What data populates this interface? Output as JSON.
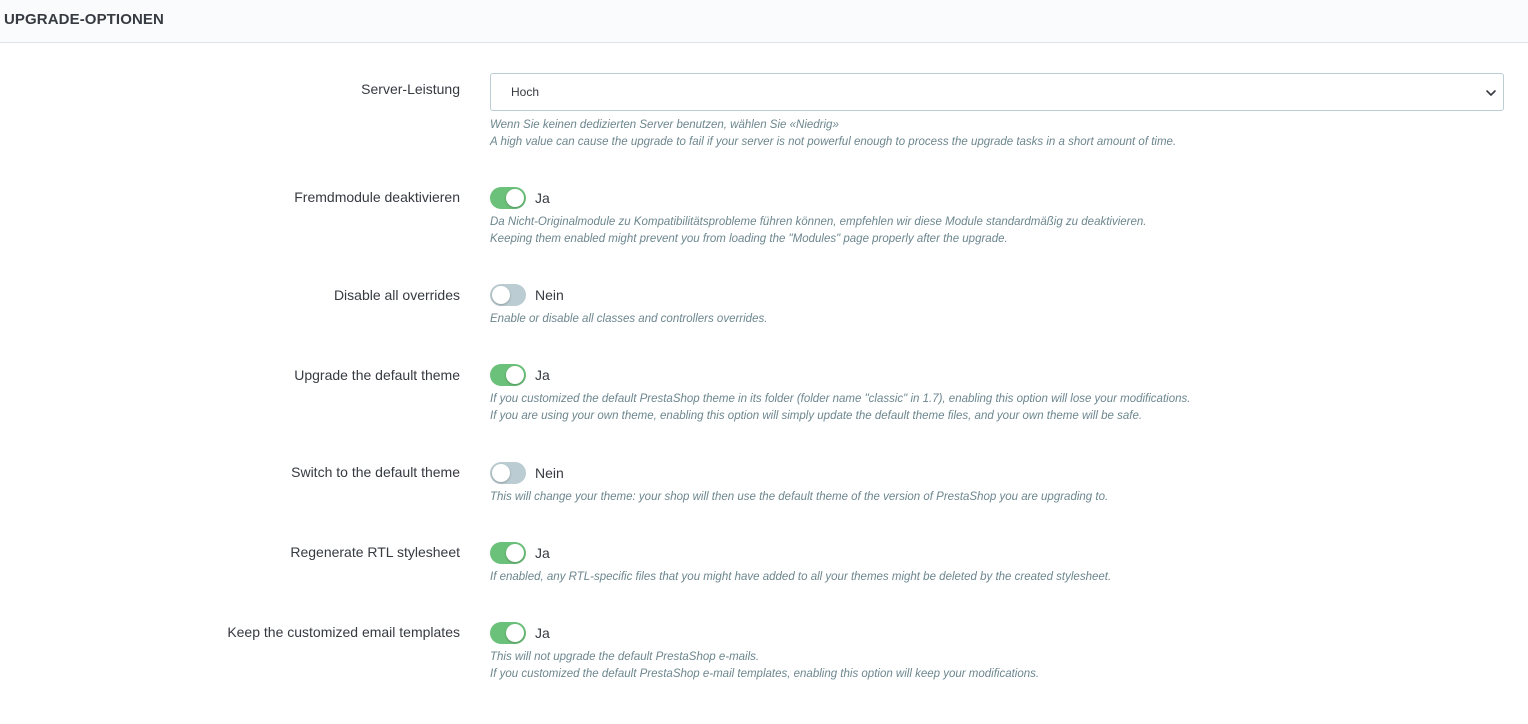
{
  "panel": {
    "title": "UPGRADE-OPTIONEN"
  },
  "colors": {
    "toggle_on": "#6cc17a",
    "toggle_off": "#bbcdd2",
    "help_text": "#6c868e"
  },
  "server_performance": {
    "label": "Server-Leistung",
    "selected": "Hoch",
    "icon": "chevron-down-icon",
    "help": [
      "Wenn Sie keinen dedizierten Server benutzen, wählen Sie «Niedrig»",
      "A high value can cause the upgrade to fail if your server is not powerful enough to process the upgrade tasks in a short amount of time."
    ]
  },
  "options": [
    {
      "label": "Fremdmodule deaktivieren",
      "enabled": true,
      "state": "Ja",
      "help": [
        "Da Nicht-Originalmodule zu Kompatibilitätsprobleme führen können, empfehlen wir diese Module standardmäßig zu deaktivieren.",
        "Keeping them enabled might prevent you from loading the \"Modules\" page properly after the upgrade."
      ]
    },
    {
      "label": "Disable all overrides",
      "enabled": false,
      "state": "Nein",
      "help": [
        "Enable or disable all classes and controllers overrides."
      ]
    },
    {
      "label": "Upgrade the default theme",
      "enabled": true,
      "state": "Ja",
      "help": [
        "If you customized the default PrestaShop theme in its folder (folder name \"classic\" in 1.7), enabling this option will lose your modifications.",
        "If you are using your own theme, enabling this option will simply update the default theme files, and your own theme will be safe."
      ]
    },
    {
      "label": "Switch to the default theme",
      "enabled": false,
      "state": "Nein",
      "help": [
        "This will change your theme: your shop will then use the default theme of the version of PrestaShop you are upgrading to."
      ]
    },
    {
      "label": "Regenerate RTL stylesheet",
      "enabled": true,
      "state": "Ja",
      "help": [
        "If enabled, any RTL-specific files that you might have added to all your themes might be deleted by the created stylesheet."
      ]
    },
    {
      "label": "Keep the customized email templates",
      "enabled": true,
      "state": "Ja",
      "help": [
        "This will not upgrade the default PrestaShop e-mails.",
        "If you customized the default PrestaShop e-mail templates, enabling this option will keep your modifications."
      ]
    }
  ]
}
